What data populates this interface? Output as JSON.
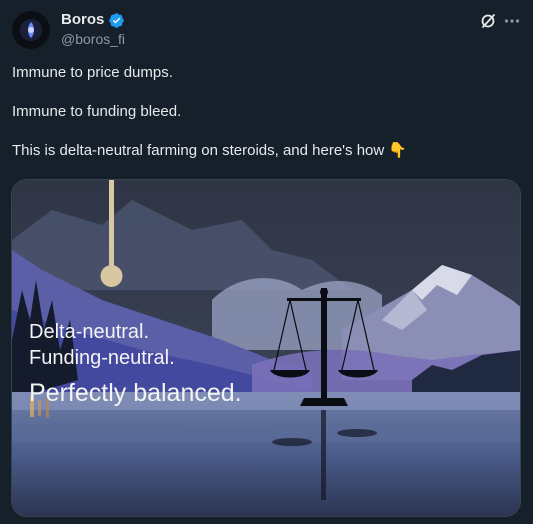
{
  "author": {
    "display_name": "Boros",
    "handle": "@boros_fi",
    "verified": true,
    "avatar_icon": "boros-logo-icon"
  },
  "actions": {
    "grok_icon": "grok-icon",
    "more_icon": "more-dots-icon"
  },
  "tweet": {
    "line1": "Immune to price dumps.",
    "line2": "Immune to funding bleed.",
    "line3": "This is delta-neutral farming on steroids, and here's how 👇"
  },
  "media": {
    "overlay_line1": "Delta-neutral.",
    "overlay_line2": "Funding-neutral.",
    "overlay_line3": "Perfectly balanced."
  },
  "colors": {
    "background": "#15202b",
    "verified_badge": "#1d9bf0",
    "secondary_text": "#8b98a5"
  }
}
